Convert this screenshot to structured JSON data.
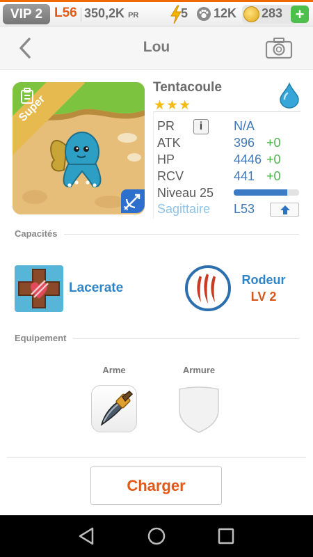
{
  "status": {
    "vip": "VIP 2",
    "level": "L56",
    "power": "350,2K",
    "power_unit": "PR",
    "energy": "5",
    "paws": "12K",
    "coins": "283",
    "add_label": "+"
  },
  "header": {
    "title": "Lou"
  },
  "monster": {
    "name": "Tentacoule",
    "stars": "★★★",
    "rarity": "Super",
    "element": "water",
    "stats": {
      "pr_label": "PR",
      "pr_value": "N/A",
      "info_label": "i",
      "atk_label": "ATK",
      "atk_value": "396",
      "atk_bonus": "+0",
      "hp_label": "HP",
      "hp_value": "4446",
      "hp_bonus": "+0",
      "rcv_label": "RCV",
      "rcv_value": "441",
      "rcv_bonus": "+0",
      "level_label": "Niveau 25",
      "level_progress": 0.82,
      "sign_label": "Sagittaire",
      "sign_level": "L53"
    }
  },
  "abilities": {
    "section_title": "Capacités",
    "skill_name": "Lacerate",
    "leader_name": "Rodeur",
    "leader_level": "LV 2"
  },
  "equipment": {
    "section_title": "Equipement",
    "weapon_label": "Arme",
    "armor_label": "Armure"
  },
  "actions": {
    "charger_label": "Charger"
  },
  "colors": {
    "accent_orange": "#e05818",
    "link_blue": "#2f83c7",
    "bonus_green": "#4cb54c",
    "coin_gold": "#e0a51a"
  },
  "icons": [
    "back-icon",
    "camera-icon",
    "bolt-icon",
    "paw-icon",
    "coin-icon",
    "water-drop-icon",
    "bow-icon",
    "info-icon",
    "upload-arrow-icon",
    "lacerate-icon",
    "claw-icon",
    "dagger-icon",
    "shield-icon",
    "nav-back-icon",
    "nav-home-icon",
    "nav-recents-icon"
  ]
}
